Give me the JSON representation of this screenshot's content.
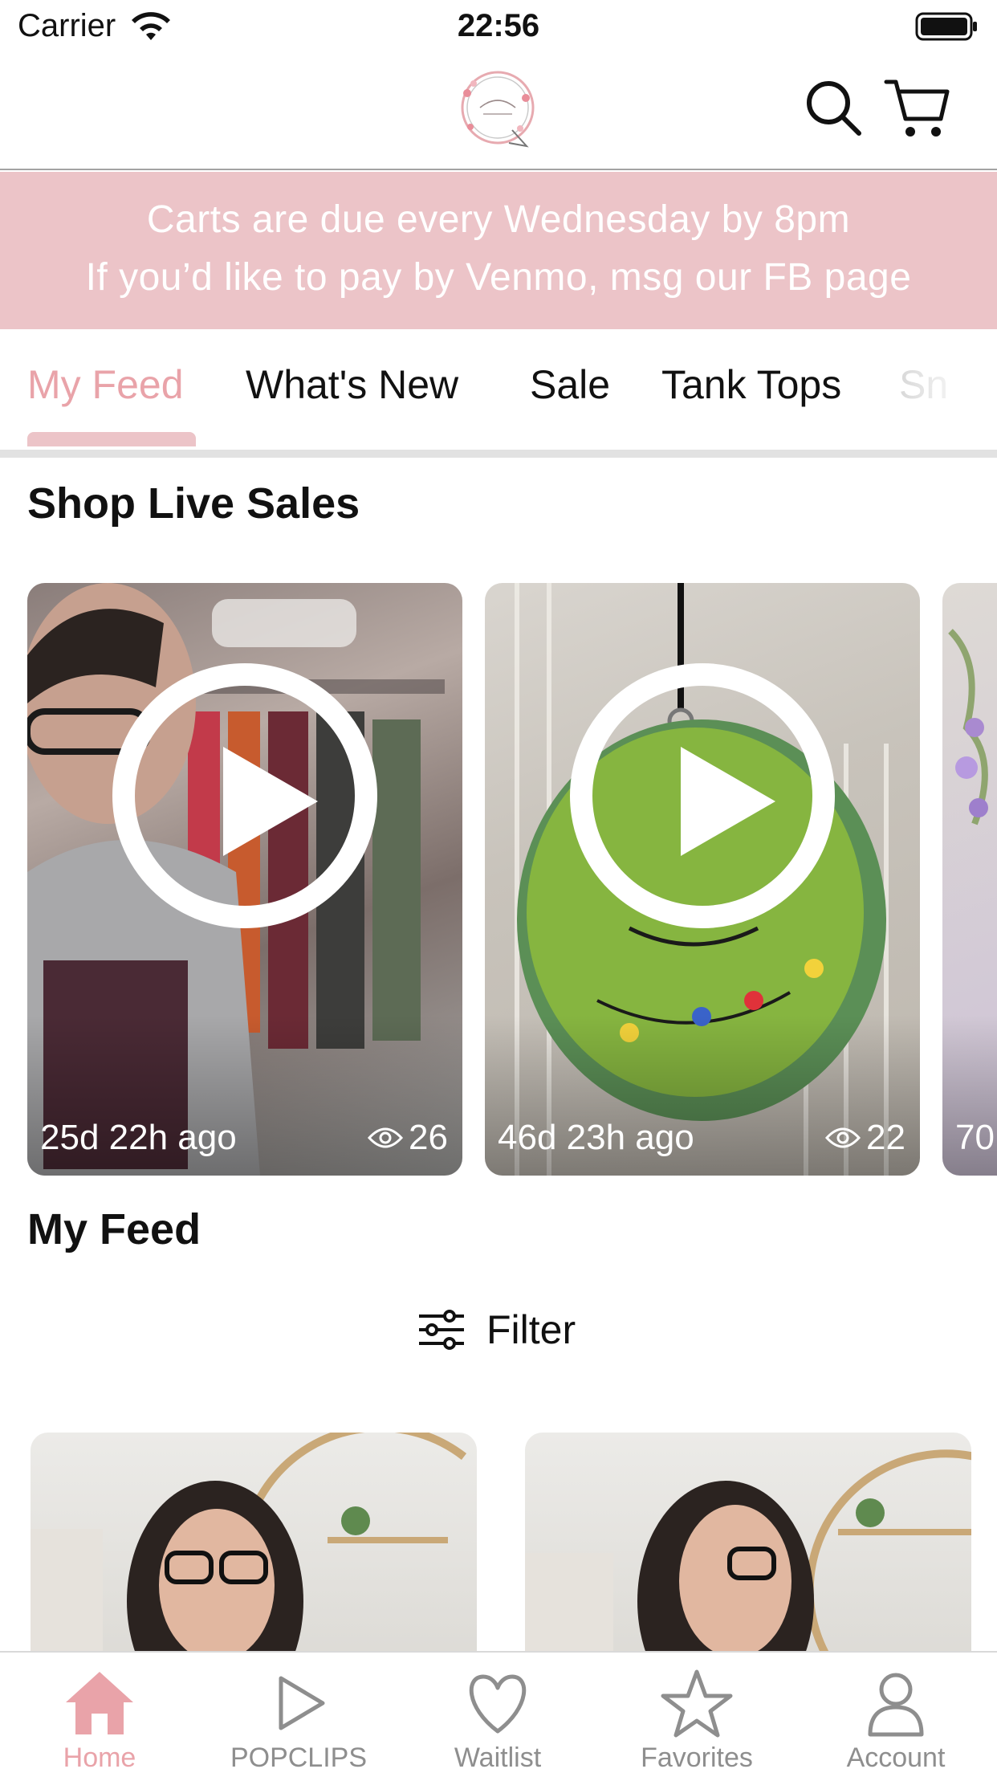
{
  "status_bar": {
    "carrier": "Carrier",
    "time": "22:56"
  },
  "header": {
    "logo_alt": "B.J. Sparkle Boutique"
  },
  "banner": {
    "line1": "Carts are due every Wednesday by 8pm",
    "line2": "If you’d like to pay by Venmo, msg our FB page"
  },
  "tabs": [
    {
      "label": "My Feed",
      "active": true
    },
    {
      "label": "What's New"
    },
    {
      "label": "Sale"
    },
    {
      "label": "Tank Tops"
    },
    {
      "label": "Sn"
    }
  ],
  "live_sales": {
    "title": "Shop Live Sales",
    "cards": [
      {
        "ago": "25d 22h ago",
        "views": "26"
      },
      {
        "ago": "46d 23h ago",
        "views": "22"
      },
      {
        "ago": "70"
      }
    ]
  },
  "feed": {
    "title": "My Feed",
    "filter_label": "Filter"
  },
  "tabbar": [
    {
      "label": "Home",
      "icon": "home-icon",
      "active": true
    },
    {
      "label": "POPCLIPS",
      "icon": "play-icon"
    },
    {
      "label": "Waitlist",
      "icon": "heart-icon"
    },
    {
      "label": "Favorites",
      "icon": "star-icon"
    },
    {
      "label": "Account",
      "icon": "person-icon"
    }
  ],
  "colors": {
    "accent": "#e9a3a9",
    "banner_bg": "#ecc4c8",
    "text": "#111111",
    "inactive": "#8e8e8e"
  }
}
